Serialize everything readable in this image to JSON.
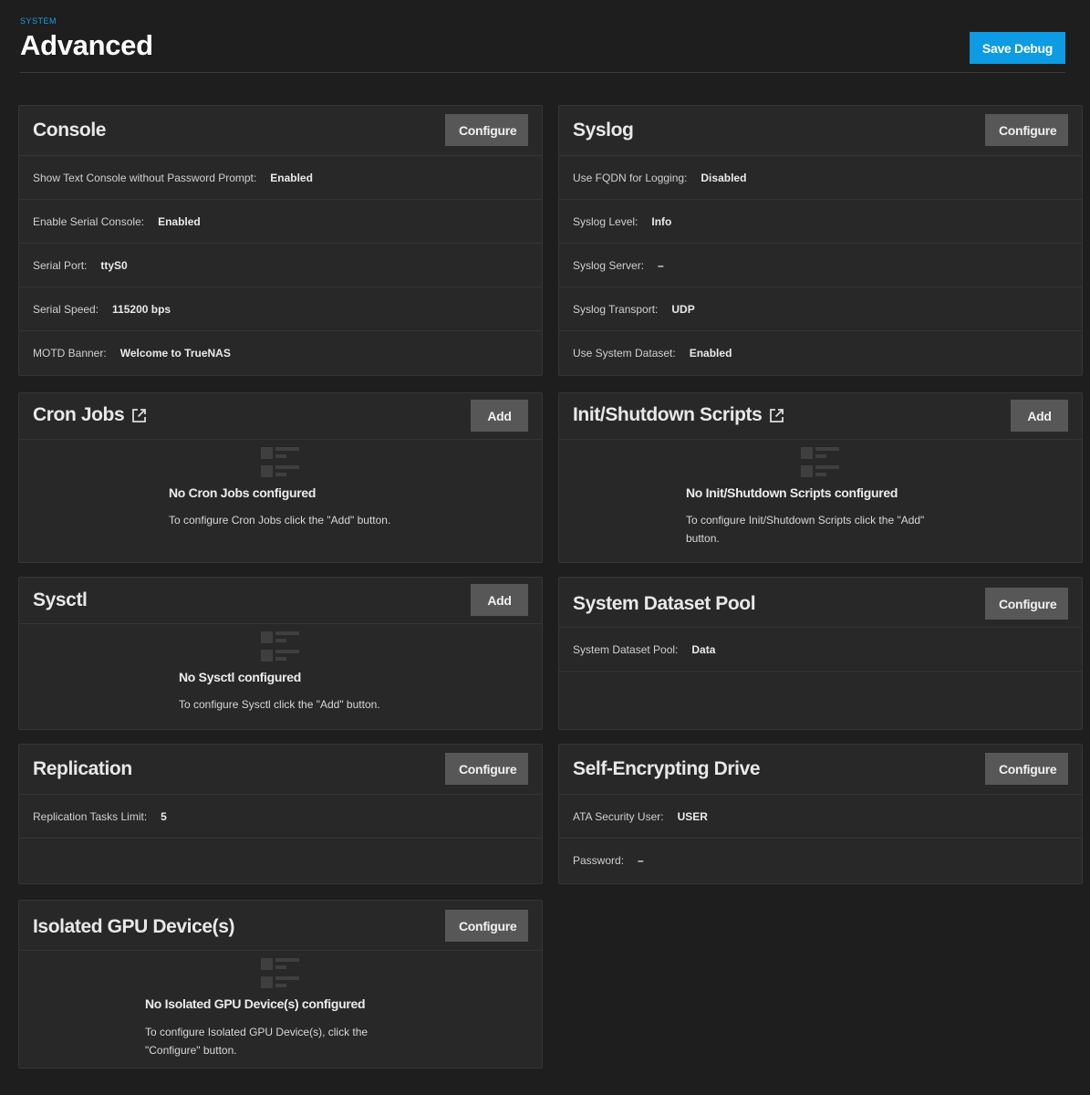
{
  "header": {
    "breadcrumb": "SYSTEM",
    "title": "Advanced",
    "save_debug_label": "Save Debug"
  },
  "console": {
    "title": "Console",
    "button": "Configure",
    "rows": [
      {
        "label": "Show Text Console without Password Prompt:",
        "value": "Enabled"
      },
      {
        "label": "Enable Serial Console:",
        "value": "Enabled"
      },
      {
        "label": "Serial Port:",
        "value": "ttyS0"
      },
      {
        "label": "Serial Speed:",
        "value": "115200 bps"
      },
      {
        "label": "MOTD Banner:",
        "value": "Welcome to TrueNAS"
      }
    ]
  },
  "syslog": {
    "title": "Syslog",
    "button": "Configure",
    "rows": [
      {
        "label": "Use FQDN for Logging:",
        "value": "Disabled"
      },
      {
        "label": "Syslog Level:",
        "value": "Info"
      },
      {
        "label": "Syslog Server:",
        "value": "–"
      },
      {
        "label": "Syslog Transport:",
        "value": "UDP"
      },
      {
        "label": "Use System Dataset:",
        "value": "Enabled"
      }
    ]
  },
  "cron_jobs": {
    "title": "Cron Jobs",
    "button": "Add",
    "empty_title": "No Cron Jobs configured",
    "empty_msg": "To configure Cron Jobs click the \"Add\" button."
  },
  "init_scripts": {
    "title": "Init/Shutdown Scripts",
    "button": "Add",
    "empty_title": "No Init/Shutdown Scripts configured",
    "empty_msg_1": "To configure Init/Shutdown Scripts click the \"Add\"",
    "empty_msg_2": "button."
  },
  "sysctl": {
    "title": "Sysctl",
    "button": "Add",
    "empty_title": "No Sysctl configured",
    "empty_msg": "To configure Sysctl click the \"Add\" button."
  },
  "dataset_pool": {
    "title": "System Dataset Pool",
    "button": "Configure",
    "rows": [
      {
        "label": "System Dataset Pool:",
        "value": "Data"
      }
    ]
  },
  "replication": {
    "title": "Replication",
    "button": "Configure",
    "rows": [
      {
        "label": "Replication Tasks Limit:",
        "value": "5"
      }
    ]
  },
  "sed": {
    "title": "Self-Encrypting Drive",
    "button": "Configure",
    "rows": [
      {
        "label": "ATA Security User:",
        "value": "USER"
      },
      {
        "label": "Password:",
        "value": "–"
      }
    ]
  },
  "gpu": {
    "title": "Isolated GPU Device(s)",
    "button": "Configure",
    "empty_title": "No Isolated GPU Device(s) configured",
    "empty_msg_1": "To configure Isolated GPU Device(s), click the",
    "empty_msg_2": "\"Configure\" button."
  },
  "icons": {
    "external_link": "external-link-icon",
    "empty_list": "empty-list-icon"
  }
}
